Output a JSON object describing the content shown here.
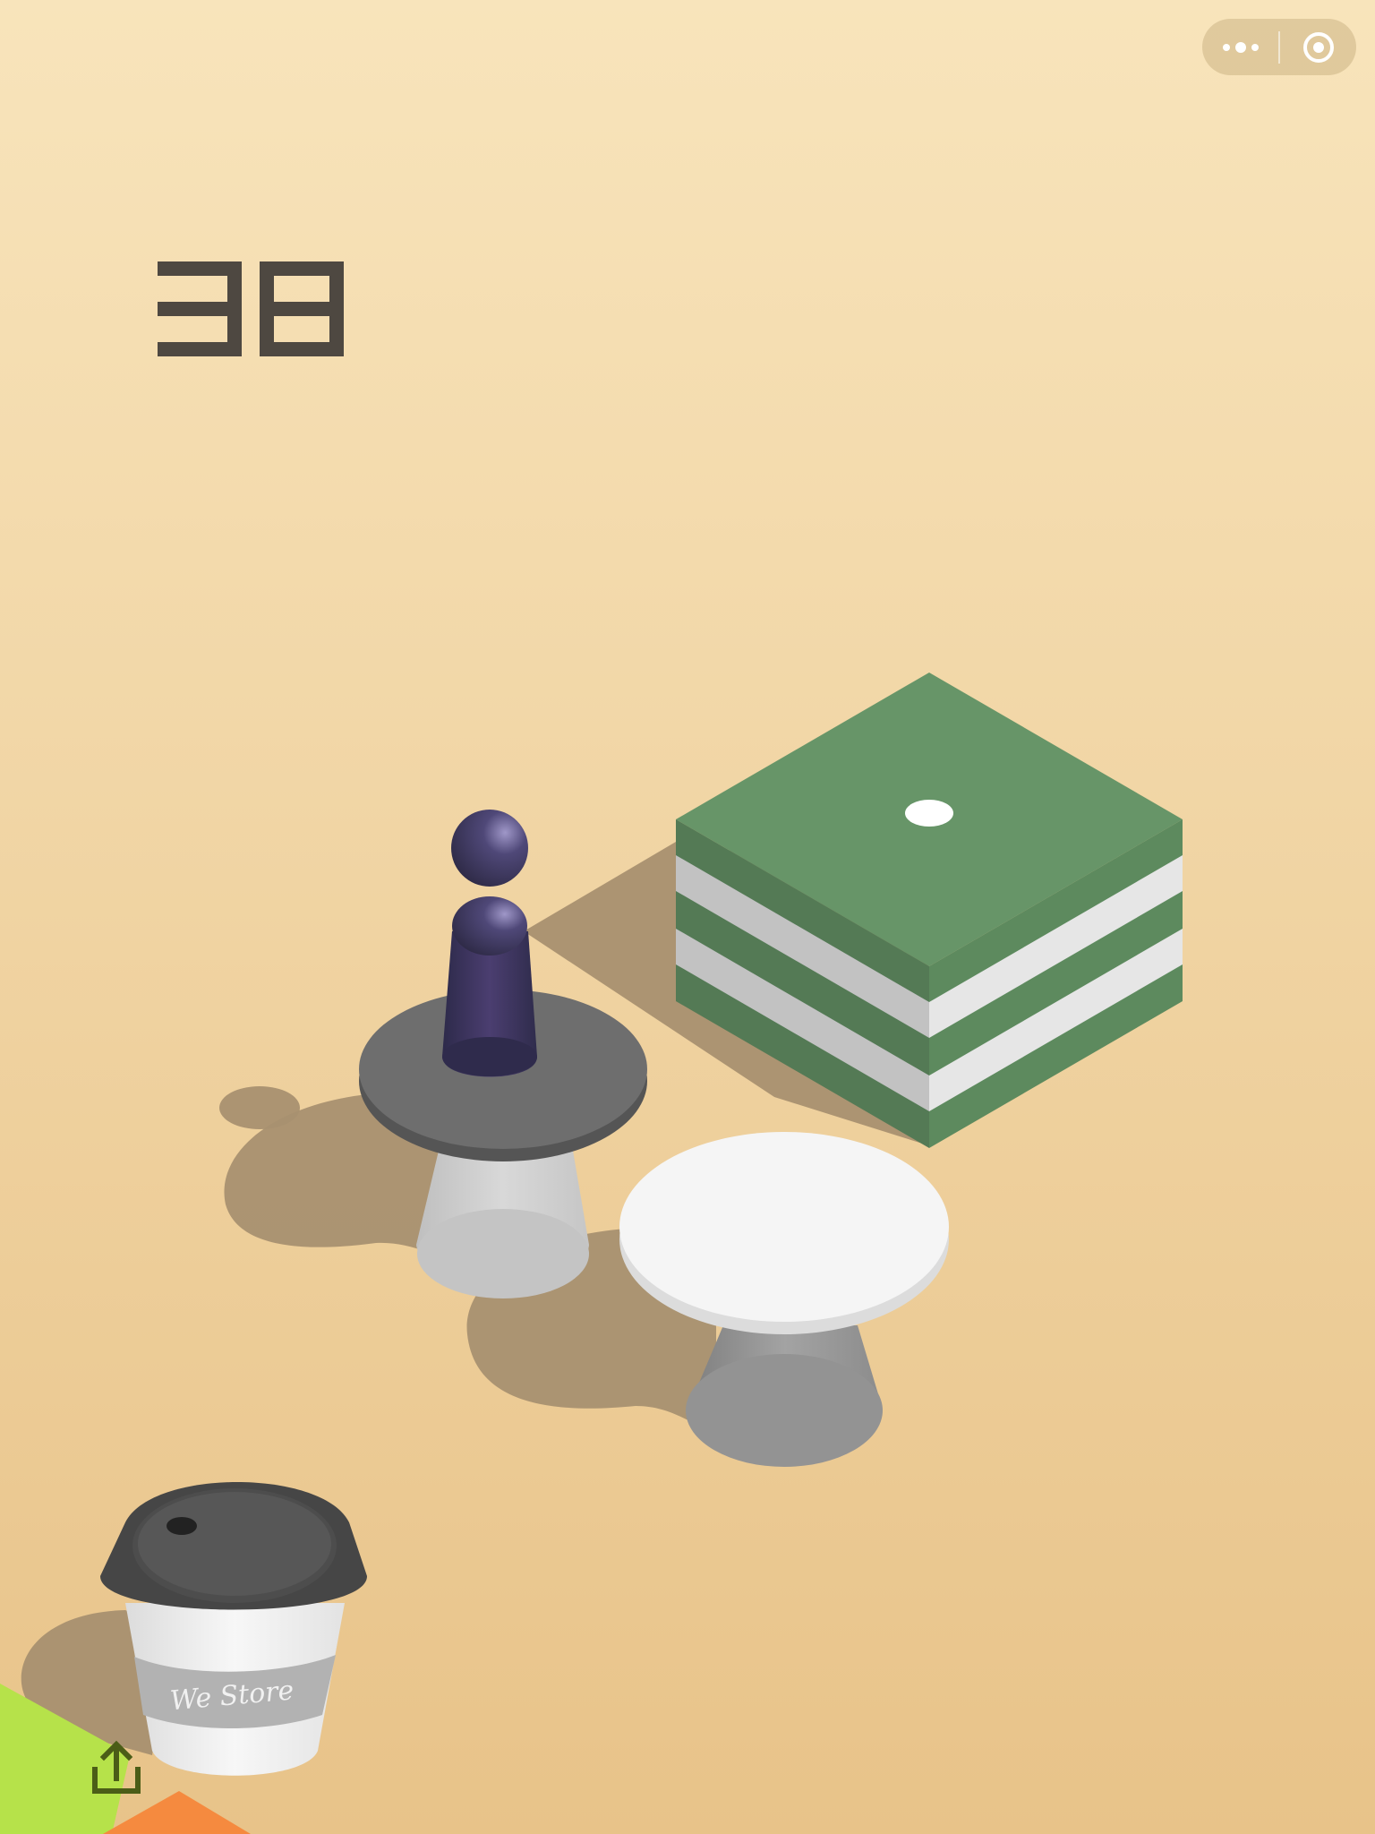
{
  "game": {
    "score": "38",
    "cup_logo_text": "We Store"
  },
  "menu_capsule": {
    "more_icon": "more-dots-icon",
    "close_icon": "target-circle-icon"
  },
  "share_icon": "share-upload-icon",
  "colors": {
    "background_top": "#f8e4bb",
    "background_bottom": "#e8c389",
    "score": "#4e4841",
    "box_green_top": "#679568",
    "box_green_left": "#547a55",
    "box_green_right": "#5d8a5e",
    "stripe_white": "#e6e6e6",
    "stripe_grey": "#c2c2c2",
    "player": "#4a4370",
    "grey_table_top": "#6e6e6e",
    "white_table_top": "#f5f5f5",
    "cup_lid": "#555555",
    "corner_green": "#b6e24a",
    "corner_orange": "#f58a3f"
  }
}
